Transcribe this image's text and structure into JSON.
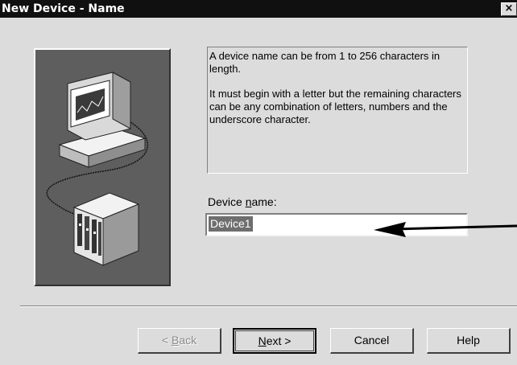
{
  "window": {
    "title": "New Device - Name",
    "close_label": "×"
  },
  "info": {
    "paragraph1": "A device name can be from 1 to 256 characters in length.",
    "paragraph2": "It must begin with a letter but the remaining characters can be any combination of letters, numbers and the underscore character."
  },
  "device_name": {
    "label_before": "Device ",
    "label_mnemonic": "n",
    "label_after": "ame:",
    "value": "Device1"
  },
  "buttons": {
    "back": {
      "prefix": "< ",
      "mnemonic": "B",
      "rest": "ack"
    },
    "next": {
      "mnemonic": "N",
      "rest": "ext >"
    },
    "cancel": "Cancel",
    "help": "Help"
  },
  "colors": {
    "title_bar": "#101010",
    "dialog_bg": "#dcdcdc",
    "illustration_bg": "#5e5e5e",
    "selection": "#6e6e6e"
  },
  "icons": [
    "computer-icon",
    "plc-rack-icon",
    "close-icon",
    "arrow-annotation"
  ]
}
